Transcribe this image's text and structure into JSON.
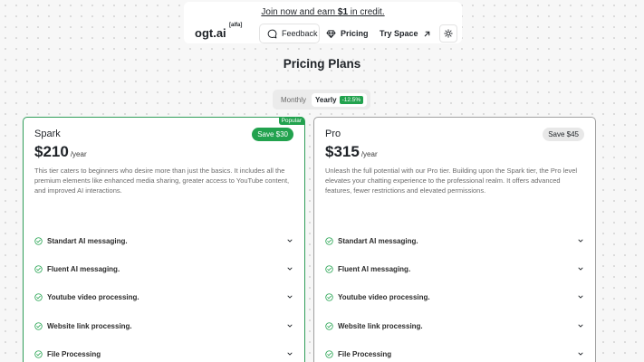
{
  "promo": {
    "prefix": "Join now and earn ",
    "amount": "$1",
    "suffix": " in credit."
  },
  "nav": {
    "logo": "ogt.ai",
    "badge": "[alfa]",
    "feedback": "Feedback",
    "pricing": "Pricing",
    "try_space": "Try Space",
    "theme_icon": "sun-icon"
  },
  "page_title": "Pricing Plans",
  "billing_toggle": {
    "monthly": "Monthly",
    "yearly": "Yearly",
    "yearly_discount": "-12.5%",
    "selected": "Yearly"
  },
  "plans": [
    {
      "name": "Spark",
      "badge": "Popular",
      "save_label": "Save $30",
      "price": "$210",
      "period": "/year",
      "description": "This tier caters to beginners who desire more than just the basics. It includes all the premium elements like enhanced media sharing, greater access to YouTube content, and improved AI interactions.",
      "features": [
        "Standart AI messaging.",
        "Fluent AI messaging.",
        "Youtube video processing.",
        "Website link processing.",
        "File Processing"
      ]
    },
    {
      "name": "Pro",
      "save_label": "Save $45",
      "price": "$315",
      "period": "/year",
      "description": "Unleash the full potential with our Pro tier. Building upon the Spark tier, the Pro level elevates your chatting experience to the professional realm. It offers advanced features, fewer restrictions and elevated permissions.",
      "features": [
        "Standart AI messaging.",
        "Fluent AI messaging.",
        "Youtube video processing.",
        "Website link processing.",
        "File Processing"
      ]
    }
  ],
  "colors": {
    "accent_green": "#22a24e",
    "spark_border": "#2f9d59"
  }
}
